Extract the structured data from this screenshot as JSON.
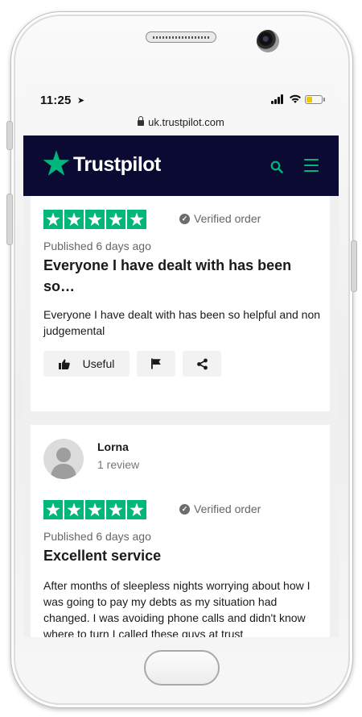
{
  "status_bar": {
    "time": "11:25"
  },
  "browser": {
    "url": "uk.trustpilot.com"
  },
  "header": {
    "brand": "Trustpilot",
    "search_icon": "search-icon",
    "menu_icon": "hamburger-menu-icon",
    "colors": {
      "background": "#0b0a33",
      "accent": "#00b67a"
    }
  },
  "reviews": [
    {
      "rating": 5,
      "verified_label": "Verified order",
      "published": "Published 6 days ago",
      "title": "Everyone I have dealt with has been so…",
      "body": "Everyone I have dealt with has been so helpful and non judgemental",
      "actions": {
        "useful_label": "Useful"
      }
    },
    {
      "reviewer_name": "Lorna",
      "review_count": "1 review",
      "rating": 5,
      "verified_label": "Verified order",
      "published": "Published 6 days ago",
      "title": "Excellent service",
      "body": "After months of sleepless nights worrying about how I was going to pay my debts as my situation had changed. I was avoiding phone calls and didn't know where to turn I called these guys at trust"
    }
  ]
}
